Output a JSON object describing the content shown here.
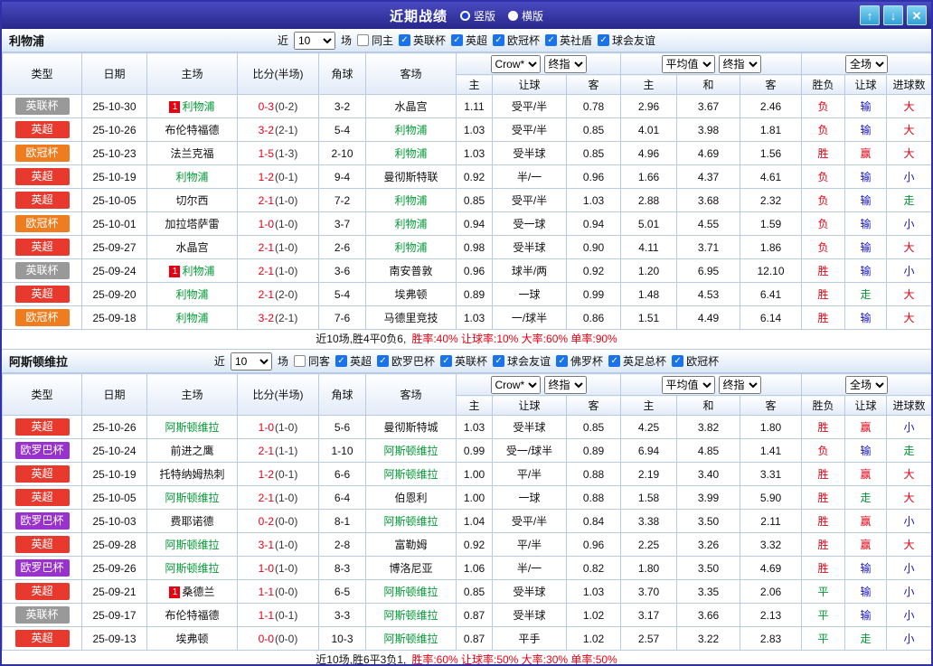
{
  "titlebar": {
    "title": "近期战绩",
    "views": [
      {
        "label": "竖版",
        "selected": true
      },
      {
        "label": "横版",
        "selected": false
      }
    ],
    "up_icon": "↑",
    "down_icon": "↓",
    "close_icon": "✕"
  },
  "columns": {
    "main": [
      "类型",
      "日期",
      "主场",
      "比分(半场)",
      "角球",
      "客场"
    ],
    "sub": [
      "主",
      "让球",
      "客",
      "主",
      "和",
      "客",
      "胜负",
      "让球",
      "进球数"
    ]
  },
  "colors": {
    "league": {
      "英超": "#e8392e",
      "欧冠杯": "#ef7d1f",
      "英联杯": "#999999",
      "欧罗巴杯": "#9932cc"
    },
    "result": {
      "red": "#e60012",
      "blue": "#1414cc",
      "green": "#009933"
    },
    "team_link": "#009933",
    "score": "#e60012"
  },
  "sections": [
    {
      "team": "利物浦",
      "filter": {
        "near_label": "近",
        "count": "10",
        "matches_label": "场",
        "checkboxes": [
          {
            "label": "同主",
            "checked": false
          },
          {
            "label": "英联杯",
            "checked": true
          },
          {
            "label": "英超",
            "checked": true
          },
          {
            "label": "欧冠杯",
            "checked": true
          },
          {
            "label": "英社盾",
            "checked": true
          },
          {
            "label": "球会友谊",
            "checked": true
          }
        ]
      },
      "selects": {
        "odds_source": "Crow*",
        "odds_stage1": "终指",
        "avg_source": "平均值",
        "odds_stage2": "终指",
        "scope": "全场"
      },
      "rows": [
        {
          "league": "英联杯",
          "date": "25-10-30",
          "home": "利物浦",
          "home_team": true,
          "home_red": "1",
          "ft": "0-3",
          "ht": "(0-2)",
          "corner": "3-2",
          "away": "水晶宫",
          "o1": "1.11",
          "hcp": "受平/半",
          "o2": "0.78",
          "a1": "2.96",
          "a2": "3.67",
          "a3": "2.46",
          "r1": [
            "负",
            "red"
          ],
          "r2": [
            "输",
            "blue"
          ],
          "r3": [
            "大",
            "red"
          ]
        },
        {
          "league": "英超",
          "date": "25-10-26",
          "home": "布伦特福德",
          "ft": "3-2",
          "ht": "(2-1)",
          "corner": "5-4",
          "away": "利物浦",
          "away_team": true,
          "o1": "1.03",
          "hcp": "受平/半",
          "o2": "0.85",
          "a1": "4.01",
          "a2": "3.98",
          "a3": "1.81",
          "r1": [
            "负",
            "red"
          ],
          "r2": [
            "输",
            "blue"
          ],
          "r3": [
            "大",
            "red"
          ]
        },
        {
          "league": "欧冠杯",
          "date": "25-10-23",
          "home": "法兰克福",
          "ft": "1-5",
          "ht": "(1-3)",
          "corner": "2-10",
          "away": "利物浦",
          "away_team": true,
          "o1": "1.03",
          "hcp": "受半球",
          "o2": "0.85",
          "a1": "4.96",
          "a2": "4.69",
          "a3": "1.56",
          "r1": [
            "胜",
            "red"
          ],
          "r2": [
            "赢",
            "red"
          ],
          "r3": [
            "大",
            "red"
          ]
        },
        {
          "league": "英超",
          "date": "25-10-19",
          "home": "利物浦",
          "home_team": true,
          "ft": "1-2",
          "ht": "(0-1)",
          "corner": "9-4",
          "away": "曼彻斯特联",
          "o1": "0.92",
          "hcp": "半/一",
          "o2": "0.96",
          "a1": "1.66",
          "a2": "4.37",
          "a3": "4.61",
          "r1": [
            "负",
            "red"
          ],
          "r2": [
            "输",
            "blue"
          ],
          "r3": [
            "小",
            "blue"
          ]
        },
        {
          "league": "英超",
          "date": "25-10-05",
          "home": "切尔西",
          "ft": "2-1",
          "ht": "(1-0)",
          "corner": "7-2",
          "away": "利物浦",
          "away_team": true,
          "o1": "0.85",
          "hcp": "受平/半",
          "o2": "1.03",
          "a1": "2.88",
          "a2": "3.68",
          "a3": "2.32",
          "r1": [
            "负",
            "red"
          ],
          "r2": [
            "输",
            "blue"
          ],
          "r3": [
            "走",
            "green"
          ]
        },
        {
          "league": "欧冠杯",
          "date": "25-10-01",
          "home": "加拉塔萨雷",
          "ft": "1-0",
          "ht": "(1-0)",
          "corner": "3-7",
          "away": "利物浦",
          "away_team": true,
          "o1": "0.94",
          "hcp": "受一球",
          "o2": "0.94",
          "a1": "5.01",
          "a2": "4.55",
          "a3": "1.59",
          "r1": [
            "负",
            "red"
          ],
          "r2": [
            "输",
            "blue"
          ],
          "r3": [
            "小",
            "blue"
          ]
        },
        {
          "league": "英超",
          "date": "25-09-27",
          "home": "水晶宫",
          "ft": "2-1",
          "ht": "(1-0)",
          "corner": "2-6",
          "away": "利物浦",
          "away_team": true,
          "o1": "0.98",
          "hcp": "受半球",
          "o2": "0.90",
          "a1": "4.11",
          "a2": "3.71",
          "a3": "1.86",
          "r1": [
            "负",
            "red"
          ],
          "r2": [
            "输",
            "blue"
          ],
          "r3": [
            "大",
            "red"
          ]
        },
        {
          "league": "英联杯",
          "date": "25-09-24",
          "home": "利物浦",
          "home_team": true,
          "home_red": "1",
          "ft": "2-1",
          "ht": "(1-0)",
          "corner": "3-6",
          "away": "南安普敦",
          "o1": "0.96",
          "hcp": "球半/两",
          "o2": "0.92",
          "a1": "1.20",
          "a2": "6.95",
          "a3": "12.10",
          "r1": [
            "胜",
            "red"
          ],
          "r2": [
            "输",
            "blue"
          ],
          "r3": [
            "小",
            "blue"
          ]
        },
        {
          "league": "英超",
          "date": "25-09-20",
          "home": "利物浦",
          "home_team": true,
          "ft": "2-1",
          "ht": "(2-0)",
          "corner": "5-4",
          "away": "埃弗顿",
          "o1": "0.89",
          "hcp": "一球",
          "o2": "0.99",
          "a1": "1.48",
          "a2": "4.53",
          "a3": "6.41",
          "r1": [
            "胜",
            "red"
          ],
          "r2": [
            "走",
            "green"
          ],
          "r3": [
            "大",
            "red"
          ]
        },
        {
          "league": "欧冠杯",
          "date": "25-09-18",
          "home": "利物浦",
          "home_team": true,
          "ft": "3-2",
          "ht": "(2-1)",
          "corner": "7-6",
          "away": "马德里竞技",
          "o1": "1.03",
          "hcp": "一/球半",
          "o2": "0.86",
          "a1": "1.51",
          "a2": "4.49",
          "a3": "6.14",
          "r1": [
            "胜",
            "red"
          ],
          "r2": [
            "输",
            "blue"
          ],
          "r3": [
            "大",
            "red"
          ]
        }
      ],
      "summary": {
        "prefix": "近10场,胜4平0负6,",
        "stats": "胜率:40% 让球率:10% 大率:60% 单率:90%"
      }
    },
    {
      "team": "阿斯顿维拉",
      "filter": {
        "near_label": "近",
        "count": "10",
        "matches_label": "场",
        "checkboxes": [
          {
            "label": "同客",
            "checked": false
          },
          {
            "label": "英超",
            "checked": true
          },
          {
            "label": "欧罗巴杯",
            "checked": true
          },
          {
            "label": "英联杯",
            "checked": true
          },
          {
            "label": "球会友谊",
            "checked": true
          },
          {
            "label": "佛罗杯",
            "checked": true
          },
          {
            "label": "英足总杯",
            "checked": true
          },
          {
            "label": "欧冠杯",
            "checked": true
          }
        ]
      },
      "selects": {
        "odds_source": "Crow*",
        "odds_stage1": "终指",
        "avg_source": "平均值",
        "odds_stage2": "终指",
        "scope": "全场"
      },
      "rows": [
        {
          "league": "英超",
          "date": "25-10-26",
          "home": "阿斯顿维拉",
          "home_team": true,
          "ft": "1-0",
          "ht": "(1-0)",
          "corner": "5-6",
          "away": "曼彻斯特城",
          "o1": "1.03",
          "hcp": "受半球",
          "o2": "0.85",
          "a1": "4.25",
          "a2": "3.82",
          "a3": "1.80",
          "r1": [
            "胜",
            "red"
          ],
          "r2": [
            "赢",
            "red"
          ],
          "r3": [
            "小",
            "blue"
          ]
        },
        {
          "league": "欧罗巴杯",
          "date": "25-10-24",
          "home": "前进之鹰",
          "ft": "2-1",
          "ht": "(1-1)",
          "corner": "1-10",
          "away": "阿斯顿维拉",
          "away_team": true,
          "o1": "0.99",
          "hcp": "受一/球半",
          "o2": "0.89",
          "a1": "6.94",
          "a2": "4.85",
          "a3": "1.41",
          "r1": [
            "负",
            "red"
          ],
          "r2": [
            "输",
            "blue"
          ],
          "r3": [
            "走",
            "green"
          ]
        },
        {
          "league": "英超",
          "date": "25-10-19",
          "home": "托特纳姆热刺",
          "ft": "1-2",
          "ht": "(0-1)",
          "corner": "6-6",
          "away": "阿斯顿维拉",
          "away_team": true,
          "o1": "1.00",
          "hcp": "平/半",
          "o2": "0.88",
          "a1": "2.19",
          "a2": "3.40",
          "a3": "3.31",
          "r1": [
            "胜",
            "red"
          ],
          "r2": [
            "赢",
            "red"
          ],
          "r3": [
            "大",
            "red"
          ]
        },
        {
          "league": "英超",
          "date": "25-10-05",
          "home": "阿斯顿维拉",
          "home_team": true,
          "ft": "2-1",
          "ht": "(1-0)",
          "corner": "6-4",
          "away": "伯恩利",
          "o1": "1.00",
          "hcp": "一球",
          "o2": "0.88",
          "a1": "1.58",
          "a2": "3.99",
          "a3": "5.90",
          "r1": [
            "胜",
            "red"
          ],
          "r2": [
            "走",
            "green"
          ],
          "r3": [
            "大",
            "red"
          ]
        },
        {
          "league": "欧罗巴杯",
          "date": "25-10-03",
          "home": "费耶诺德",
          "ft": "0-2",
          "ht": "(0-0)",
          "corner": "8-1",
          "away": "阿斯顿维拉",
          "away_team": true,
          "o1": "1.04",
          "hcp": "受平/半",
          "o2": "0.84",
          "a1": "3.38",
          "a2": "3.50",
          "a3": "2.11",
          "r1": [
            "胜",
            "red"
          ],
          "r2": [
            "赢",
            "red"
          ],
          "r3": [
            "小",
            "blue"
          ]
        },
        {
          "league": "英超",
          "date": "25-09-28",
          "home": "阿斯顿维拉",
          "home_team": true,
          "ft": "3-1",
          "ht": "(1-0)",
          "corner": "2-8",
          "away": "富勒姆",
          "o1": "0.92",
          "hcp": "平/半",
          "o2": "0.96",
          "a1": "2.25",
          "a2": "3.26",
          "a3": "3.32",
          "r1": [
            "胜",
            "red"
          ],
          "r2": [
            "赢",
            "red"
          ],
          "r3": [
            "大",
            "red"
          ]
        },
        {
          "league": "欧罗巴杯",
          "date": "25-09-26",
          "home": "阿斯顿维拉",
          "home_team": true,
          "ft": "1-0",
          "ht": "(1-0)",
          "corner": "8-3",
          "away": "博洛尼亚",
          "o1": "1.06",
          "hcp": "半/一",
          "o2": "0.82",
          "a1": "1.80",
          "a2": "3.50",
          "a3": "4.69",
          "r1": [
            "胜",
            "red"
          ],
          "r2": [
            "输",
            "blue"
          ],
          "r3": [
            "小",
            "blue"
          ]
        },
        {
          "league": "英超",
          "date": "25-09-21",
          "home": "桑德兰",
          "home_red": "1",
          "ft": "1-1",
          "ht": "(0-0)",
          "corner": "6-5",
          "away": "阿斯顿维拉",
          "away_team": true,
          "o1": "0.85",
          "hcp": "受半球",
          "o2": "1.03",
          "a1": "3.70",
          "a2": "3.35",
          "a3": "2.06",
          "r1": [
            "平",
            "green"
          ],
          "r2": [
            "输",
            "blue"
          ],
          "r3": [
            "小",
            "blue"
          ]
        },
        {
          "league": "英联杯",
          "date": "25-09-17",
          "home": "布伦特福德",
          "ft": "1-1",
          "ht": "(0-1)",
          "corner": "3-3",
          "away": "阿斯顿维拉",
          "away_team": true,
          "o1": "0.87",
          "hcp": "受半球",
          "o2": "1.02",
          "a1": "3.17",
          "a2": "3.66",
          "a3": "2.13",
          "r1": [
            "平",
            "green"
          ],
          "r2": [
            "输",
            "blue"
          ],
          "r3": [
            "小",
            "blue"
          ]
        },
        {
          "league": "英超",
          "date": "25-09-13",
          "home": "埃弗顿",
          "ft": "0-0",
          "ht": "(0-0)",
          "corner": "10-3",
          "away": "阿斯顿维拉",
          "away_team": true,
          "o1": "0.87",
          "hcp": "平手",
          "o2": "1.02",
          "a1": "2.57",
          "a2": "3.22",
          "a3": "2.83",
          "r1": [
            "平",
            "green"
          ],
          "r2": [
            "走",
            "green"
          ],
          "r3": [
            "小",
            "blue"
          ]
        }
      ],
      "summary": {
        "prefix": "近10场,胜6平3负1,",
        "stats": "胜率:60% 让球率:50% 大率:30% 单率:50%"
      }
    }
  ]
}
